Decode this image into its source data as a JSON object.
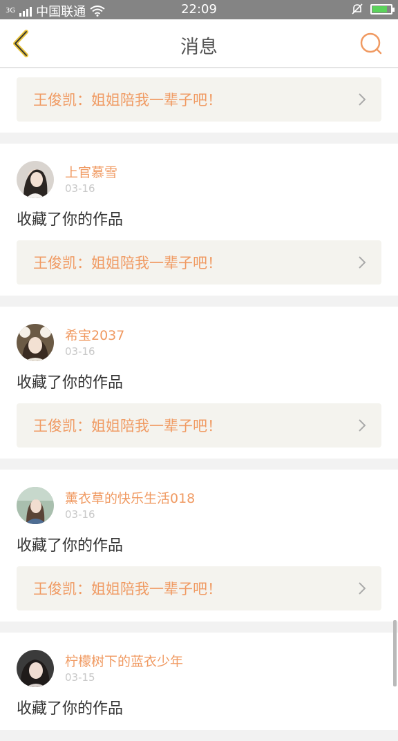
{
  "status": {
    "network": "3G",
    "carrier": "中国联通",
    "time": "22:09",
    "battery_color": "#5bd35b"
  },
  "header": {
    "title": "消息",
    "back_icon": "chevron-left-icon",
    "search_icon": "search-icon",
    "accent_color": "#f09a62"
  },
  "first_card": {
    "work_title": "王俊凯：姐姐陪我一辈子吧！"
  },
  "messages": [
    {
      "user": "上官慕雪",
      "date": "03-16",
      "action": "收藏了你的作品",
      "work_title": "王俊凯：姐姐陪我一辈子吧！"
    },
    {
      "user": "希宝2037",
      "date": "03-16",
      "action": "收藏了你的作品",
      "work_title": "王俊凯：姐姐陪我一辈子吧！"
    },
    {
      "user": "薰衣草的快乐生活018",
      "date": "03-16",
      "action": "收藏了你的作品",
      "work_title": "王俊凯：姐姐陪我一辈子吧！"
    },
    {
      "user": "柠檬树下的蓝衣少年",
      "date": "03-15",
      "action": "收藏了你的作品"
    }
  ]
}
